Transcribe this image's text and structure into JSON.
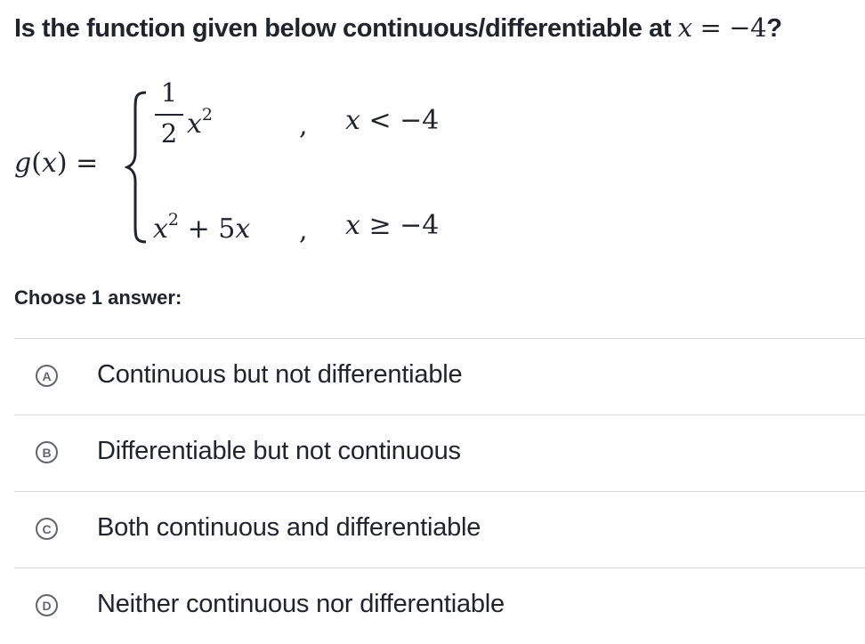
{
  "question": {
    "prefix": "Is the function given below continuous/differentiable at ",
    "var": "x",
    "eq": " = ",
    "value": "−4",
    "suffix": "?"
  },
  "function": {
    "name": "g",
    "arg": "x",
    "equals": "=",
    "piece1": {
      "numerator": "1",
      "denominator": "2",
      "var": "x",
      "exponent": "2",
      "comma": ",",
      "cond_var": "x",
      "cond_op": "<",
      "cond_value": "−4"
    },
    "piece2": {
      "var": "x",
      "exponent": "2",
      "plus": "+",
      "coef": "5",
      "var2": "x",
      "comma": ",",
      "cond_var": "x",
      "cond_op": "≥",
      "cond_value": "−4"
    }
  },
  "choose_label": "Choose 1 answer:",
  "choices": [
    {
      "letter": "A",
      "text": "Continuous but not differentiable"
    },
    {
      "letter": "B",
      "text": "Differentiable but not continuous"
    },
    {
      "letter": "C",
      "text": "Both continuous and differentiable"
    },
    {
      "letter": "D",
      "text": "Neither continuous nor differentiable"
    }
  ]
}
